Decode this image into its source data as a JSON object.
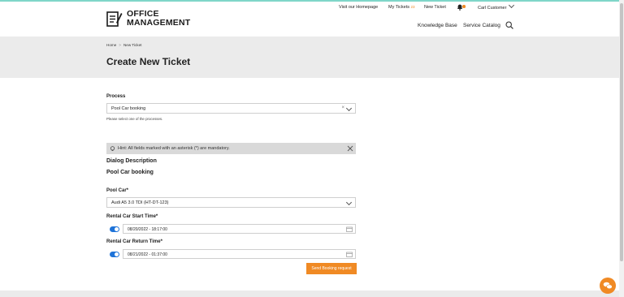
{
  "brand": {
    "line1": "OFFICE",
    "line2": "MANAGEMENT"
  },
  "topnav": {
    "homepage": "Visit our Homepage",
    "my_tickets": "My Tickets",
    "my_tickets_count": "23",
    "new_ticket": "New Ticket",
    "user": "Carl Customer"
  },
  "mainnav": {
    "knowledge_base": "Knowledge Base",
    "service_catalog": "Service Catalog"
  },
  "breadcrumb": {
    "home": "Home",
    "current": "New Ticket"
  },
  "page": {
    "title": "Create New Ticket"
  },
  "form": {
    "process_label": "Process",
    "process_value": "Pool Car booking",
    "process_help": "Please select one of the processes.",
    "hint": "Hint: All fields marked with an asterisk (*) are mandatory.",
    "dialog_description": "Dialog Description",
    "dialog_subtitle": "Pool Car booking",
    "pool_car_label": "Pool Car*",
    "pool_car_value": "Audi A5 3.0 TDI (HT-DT-123)",
    "start_label": "Rental Car Start Time*",
    "start_value": "08/20/2022 - 18:17:00",
    "return_label": "Rental Car Return Time*",
    "return_value": "08/21/2022 - 01:37:00",
    "submit": "Send Booking request"
  },
  "colors": {
    "accent": "#f08a24",
    "toggle": "#1e73d8",
    "hero_bg": "#ebebeb"
  }
}
